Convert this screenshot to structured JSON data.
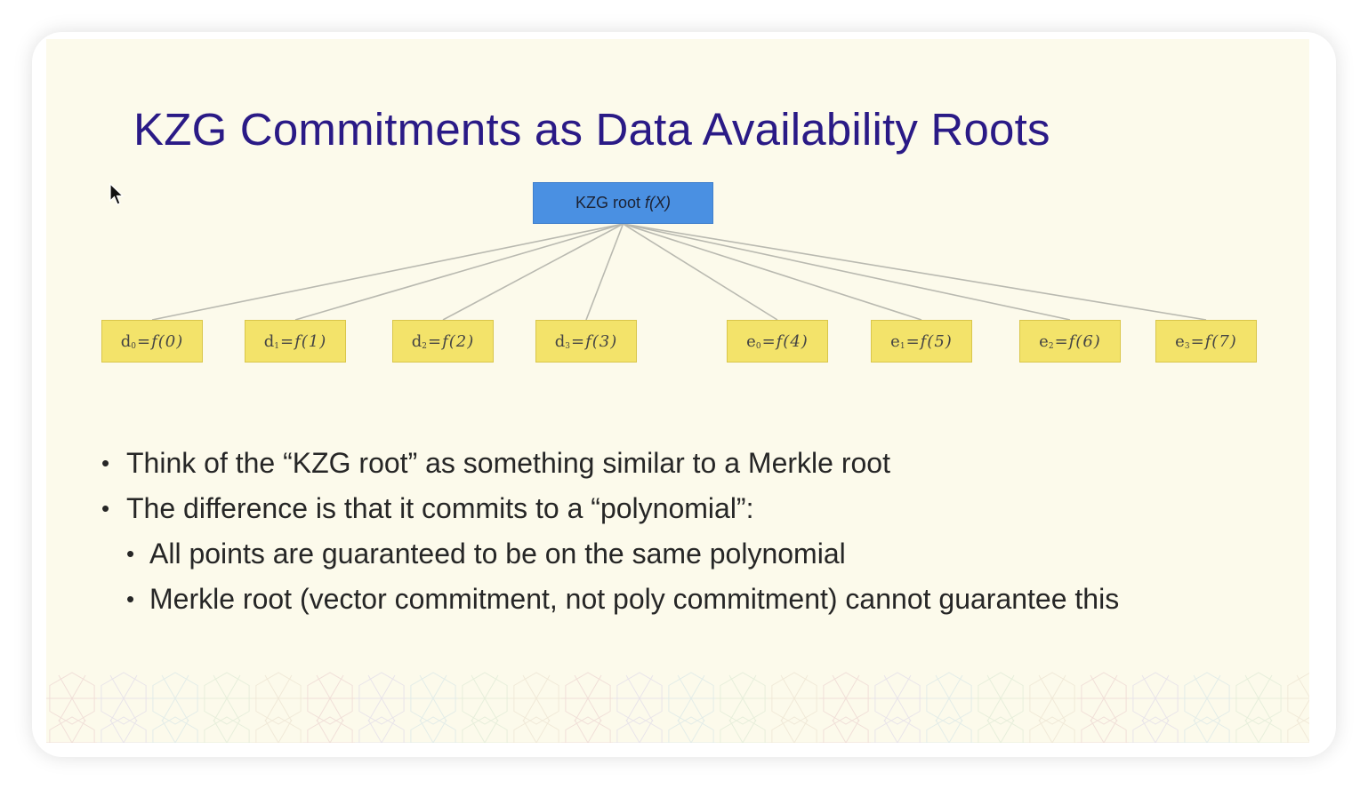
{
  "slide": {
    "title": "KZG Commitments as Data Availability Roots",
    "root_node": {
      "label": "KZG root",
      "fn": "f(X)"
    },
    "leaves": [
      {
        "var": "d",
        "sub": "0",
        "fn": "=f(0)"
      },
      {
        "var": "d",
        "sub": "1",
        "fn": "=f(1)"
      },
      {
        "var": "d",
        "sub": "2",
        "fn": "=f(2)"
      },
      {
        "var": "d",
        "sub": "3",
        "fn": "=f(3)"
      },
      {
        "var": "e",
        "sub": "0",
        "fn": "=f(4)"
      },
      {
        "var": "e",
        "sub": "1",
        "fn": "=f(5)"
      },
      {
        "var": "e",
        "sub": "2",
        "fn": "=f(6)"
      },
      {
        "var": "e",
        "sub": "3",
        "fn": "=f(7)"
      }
    ],
    "bullets": [
      {
        "level": 1,
        "text": "Think of the “KZG root” as something similar to a Merkle root"
      },
      {
        "level": 1,
        "text": "The difference is that it commits to a “polynomial”:"
      },
      {
        "level": 2,
        "text": "All points are guaranteed to be on the same polynomial"
      },
      {
        "level": 2,
        "text": "Merkle root (vector commitment, not poly commitment) cannot guarantee this"
      }
    ],
    "colors": {
      "background": "#fcfaeb",
      "title": "#2a1a86",
      "root_node": "#4a90e2",
      "leaf_node": "#f3e36a",
      "edge": "#b9b9b0"
    }
  }
}
